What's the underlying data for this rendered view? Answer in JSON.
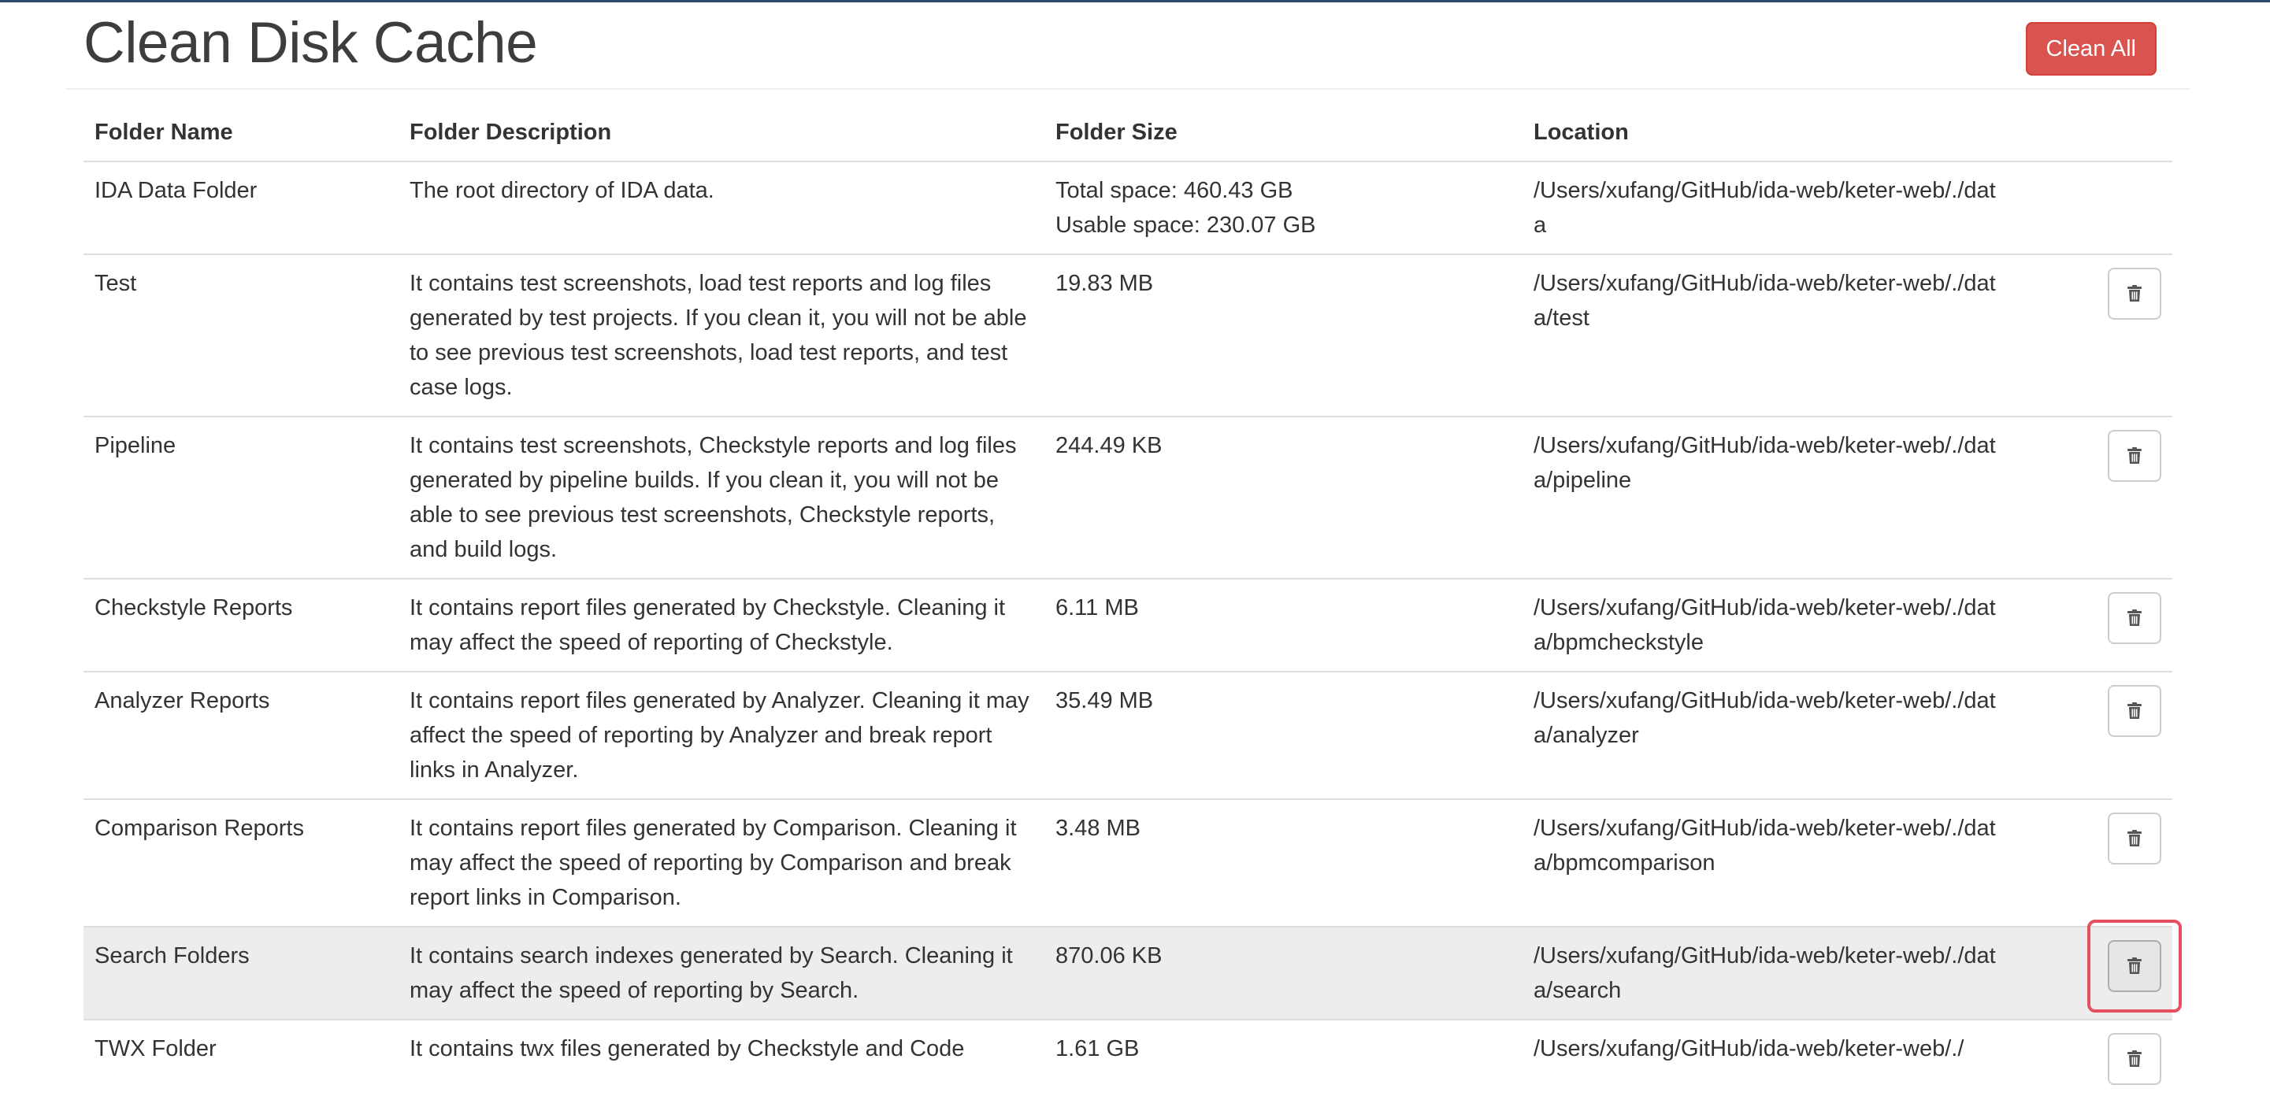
{
  "header": {
    "title": "Clean Disk Cache",
    "clean_all_label": "Clean All"
  },
  "table": {
    "columns": {
      "name": "Folder Name",
      "description": "Folder Description",
      "size": "Folder Size",
      "location": "Location"
    },
    "rows": [
      {
        "name": "IDA Data Folder",
        "description": "The root directory of IDA data.",
        "size_lines": [
          "Total space: 460.43 GB",
          "Usable space: 230.07 GB"
        ],
        "location": "/Users/xufang/GitHub/ida-web/keter-web/./data",
        "has_delete": false
      },
      {
        "name": "Test",
        "description": "It contains test screenshots, load test reports and log files generated by test projects. If you clean it, you will not be able to see previous test screenshots, load test reports, and test case logs.",
        "size": "19.83 MB",
        "location": "/Users/xufang/GitHub/ida-web/keter-web/./data/test",
        "has_delete": true
      },
      {
        "name": "Pipeline",
        "description": "It contains test screenshots, Checkstyle reports and log files generated by pipeline builds. If you clean it, you will not be able to see previous test screenshots, Checkstyle reports, and build logs.",
        "size": "244.49 KB",
        "location": "/Users/xufang/GitHub/ida-web/keter-web/./data/pipeline",
        "has_delete": true
      },
      {
        "name": "Checkstyle Reports",
        "description": "It contains report files generated by Checkstyle. Cleaning it may affect the speed of reporting of Checkstyle.",
        "size": "6.11 MB",
        "location": "/Users/xufang/GitHub/ida-web/keter-web/./data/bpmcheckstyle",
        "has_delete": true
      },
      {
        "name": "Analyzer Reports",
        "description": "It contains report files generated by Analyzer. Cleaning it may affect the speed of reporting by Analyzer and break report links in Analyzer.",
        "size": "35.49 MB",
        "location": "/Users/xufang/GitHub/ida-web/keter-web/./data/analyzer",
        "has_delete": true
      },
      {
        "name": "Comparison Reports",
        "description": "It contains report files generated by Comparison. Cleaning it may affect the speed of reporting by Comparison and break report links in Comparison.",
        "size": "3.48 MB",
        "location": "/Users/xufang/GitHub/ida-web/keter-web/./data/bpmcomparison",
        "has_delete": true
      },
      {
        "name": "Search Folders",
        "description": "It contains search indexes generated by Search. Cleaning it may affect the speed of reporting by Search.",
        "size": "870.06 KB",
        "location": "/Users/xufang/GitHub/ida-web/keter-web/./data/search",
        "has_delete": true,
        "highlighted": true
      },
      {
        "name": "TWX Folder",
        "description": "It contains twx files generated by Checkstyle and Code",
        "size": "1.61 GB",
        "location": "/Users/xufang/GitHub/ida-web/keter-web/./",
        "has_delete": true
      }
    ]
  },
  "icons": {
    "delete": "trash-icon"
  },
  "colors": {
    "danger": "#d9534f",
    "highlight_row": "#ededed",
    "focus_ring": "#e4505f"
  }
}
